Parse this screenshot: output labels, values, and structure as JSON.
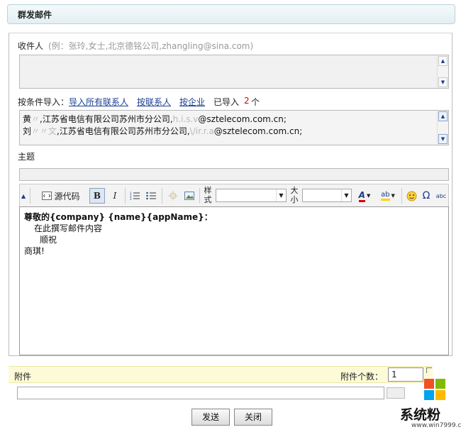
{
  "window": {
    "title": "群发邮件"
  },
  "recipients": {
    "label": "收件人",
    "hint": "(例：张玲,女士,北京德铭公司,zhangling@sina.com)"
  },
  "import": {
    "label": "按条件导入：",
    "links": [
      "导入所有联系人",
      "按联系人",
      "按企业"
    ],
    "imported_prefix": "已导入",
    "imported_count": "2",
    "imported_suffix": "个"
  },
  "contacts": [
    {
      "start": "黄",
      "blur1": "〃",
      "mid": ",江苏省电信有限公司苏州市分公司,",
      "blur2": "h.i.s.v",
      "end": "@sztelecom.com.cn;"
    },
    {
      "start": "刘",
      "blur1": "〃〃文",
      "mid": ",江苏省电信有限公司苏州市分公司,",
      "blur2": "\\/ir.r.a",
      "end": "@sztelecom.com.cn;"
    }
  ],
  "subject": {
    "label": "主题"
  },
  "toolbar": {
    "source_label": "源代码",
    "bold": "B",
    "italic": "I",
    "style_label_1": "样",
    "style_label_2": "式",
    "size_label_1": "大",
    "size_label_2": "小",
    "font_color": "A",
    "bg_color": "ab",
    "omega": "Ω",
    "abc": "abc"
  },
  "editor": {
    "lines": [
      "尊敬的{company} {name}{appName}：",
      "在此撰写邮件内容",
      "顺祝",
      "商琪!"
    ]
  },
  "attachment": {
    "label": "附件",
    "count_label": "附件个数：",
    "count_value": "1"
  },
  "buttons": {
    "send": "发送",
    "close": "关闭"
  },
  "watermark": {
    "brand": "系统粉",
    "url": "www.win7999.com"
  },
  "colors": {
    "link": "#1c3f94",
    "count": "#e00000",
    "attach_bg": "#fdfbd7"
  }
}
